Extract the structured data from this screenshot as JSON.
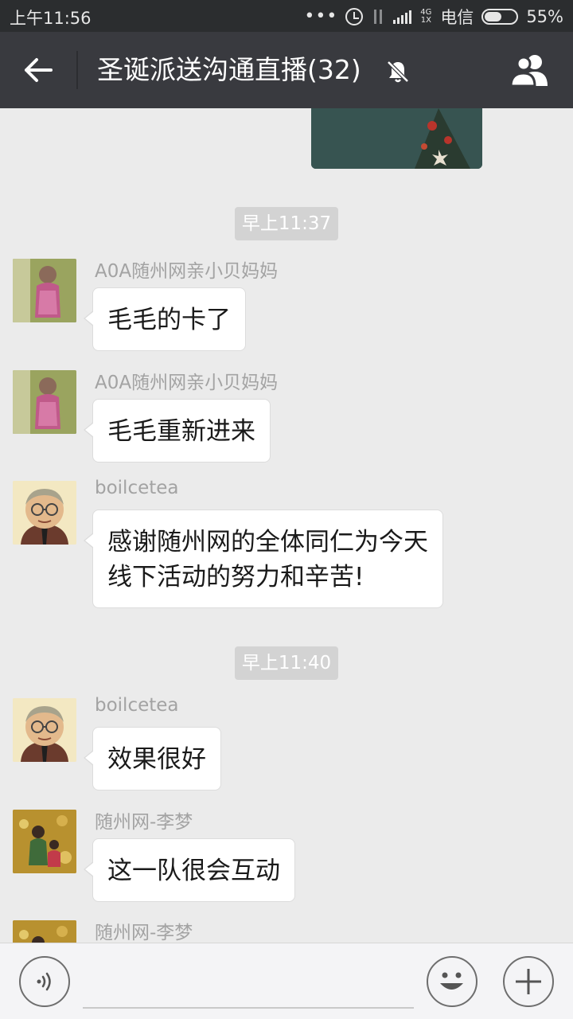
{
  "status_bar": {
    "time": "上午11:56",
    "signal_bars": 5,
    "network": "4G 1X",
    "carrier": "电信",
    "battery_percent": 55,
    "battery_label": "55%"
  },
  "header": {
    "title": "圣诞派送沟通直播(32)",
    "muted": true
  },
  "messages": [
    {
      "type": "time",
      "text": "早上11:37"
    },
    {
      "type": "text",
      "sender": "A0A随州网亲小贝妈妈",
      "avatar": "avatar-mom",
      "lines": [
        "毛毛的卡了"
      ]
    },
    {
      "type": "text",
      "sender": "A0A随州网亲小贝妈妈",
      "avatar": "avatar-mom",
      "lines": [
        "毛毛重新进来"
      ]
    },
    {
      "type": "text",
      "sender": "boilcetea",
      "avatar": "avatar-tea",
      "lines": [
        "感谢随州网的全体同仁为今天",
        "线下活动的努力和辛苦!"
      ]
    },
    {
      "type": "time",
      "text": "早上11:40"
    },
    {
      "type": "text",
      "sender": "boilcetea",
      "avatar": "avatar-tea",
      "lines": [
        "效果很好"
      ]
    },
    {
      "type": "text",
      "sender": "随州网-李梦",
      "avatar": "avatar-li",
      "lines": [
        "这一队很会互动"
      ]
    },
    {
      "type": "text",
      "sender": "随州网-李梦",
      "avatar": "avatar-li",
      "lines": []
    }
  ],
  "input_bar": {
    "text_value": "",
    "voice_icon": "voice-icon",
    "emoji_icon": "emoji-icon",
    "plus_icon": "plus-icon"
  },
  "colors": {
    "status_bar": "#2b2d2f",
    "title_bar": "#393a3f",
    "chat_bg": "#ebebeb",
    "bubble": "#ffffff",
    "time_badge": "#d3d3d3"
  }
}
